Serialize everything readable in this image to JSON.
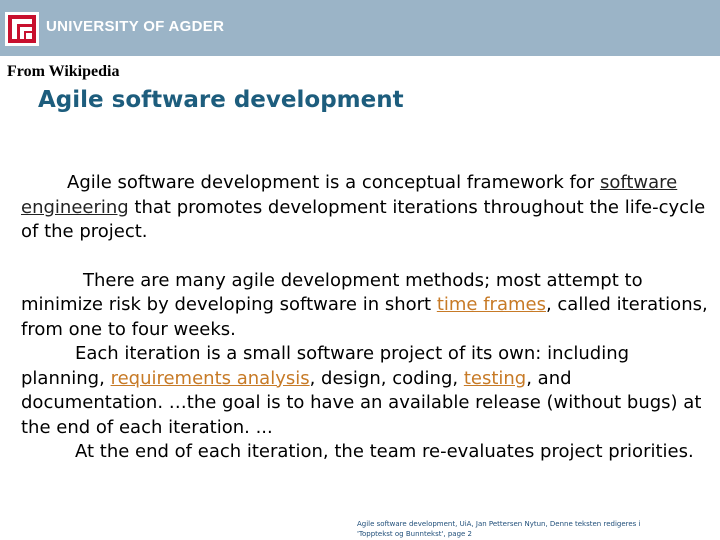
{
  "header": {
    "logo_text": "UNIVERSITY OF AGDER",
    "banner_color": "#9bb4c7"
  },
  "source": "From Wikipedia",
  "title": "Agile software development",
  "paragraphs": {
    "p1": {
      "t1": "Agile software development is a conceptual framework for ",
      "link1": "software engineering",
      "t2": " that promotes development iterations throughout the life-cycle of the project."
    },
    "p2": {
      "t1": "There are many agile development methods; most attempt to minimize risk by developing software in short ",
      "link1": "time frames",
      "t2": ", called iterations, from one to four weeks."
    },
    "p3": {
      "t1": "Each iteration is a small software project of its own: including planning, ",
      "link1": "requirements analysis",
      "t2": ", design, coding, ",
      "link2": "testing",
      "t3": ", and documentation. …the goal is to have an available release (without bugs) at the end of each iteration. ..."
    },
    "p4": {
      "t1": "At the end of each iteration, the team re-evaluates project priorities."
    }
  },
  "footer": {
    "line1": "Agile software development, UiA, Jan Pettersen Nytun, Denne teksten redigeres i",
    "line2": "'Topptekst og Bunntekst', page 2"
  },
  "colors": {
    "title": "#1d5d7d",
    "link": "#c77a26",
    "footer_text": "#1f4e79"
  }
}
